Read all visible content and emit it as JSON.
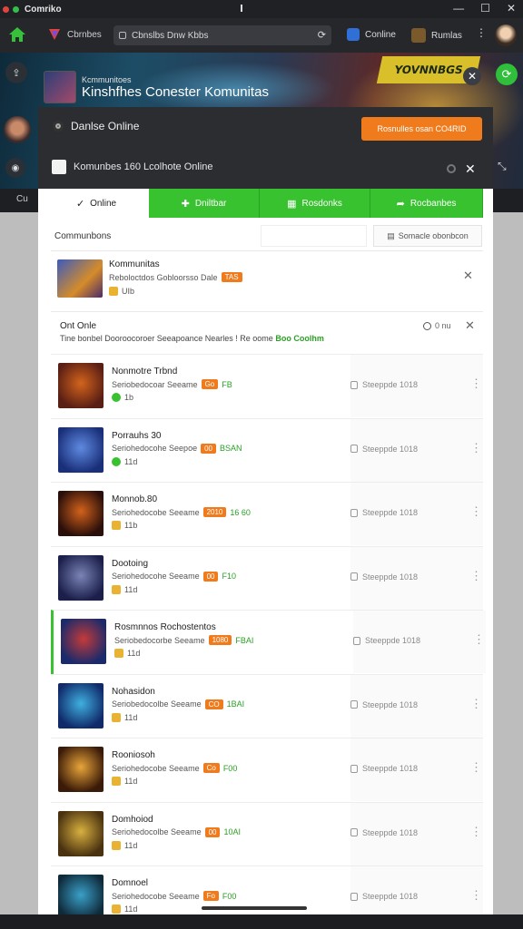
{
  "window": {
    "title": "Comriko",
    "controls": [
      "—",
      "☐",
      "✕"
    ]
  },
  "toolbar": {
    "brand_label": "Cbrnbes",
    "url": "Cbnslbs Dnw Kbbs",
    "online_label": "Conline",
    "forums_label": "Rumlas",
    "more": "⋮"
  },
  "banner": {
    "logo_text": "YOVNNBGS",
    "community_sub": "Kcmmunitoes",
    "community_title": "Kinshfhes Conester Komunitas",
    "close": "✕"
  },
  "panel": {
    "status_label": "Danlse Online",
    "join_button": "Rosnulles osan CO4RID",
    "search_label": "Komunbes  160  Lcolhote Online",
    "close": "✕"
  },
  "substrip": {
    "left": "Cu"
  },
  "tabs": [
    {
      "label": "Online",
      "icon": "check-icon",
      "active": true
    },
    {
      "label": "Dniltbar",
      "icon": "plus-icon",
      "active": false
    },
    {
      "label": "Rosdonks",
      "icon": "grid-icon",
      "active": false
    },
    {
      "label": "Rocbanbes",
      "icon": "share-icon",
      "active": false
    }
  ],
  "filter": {
    "label": "Communbons",
    "input_placeholder": "",
    "sort_button": "Somacle obonbcon"
  },
  "featured": {
    "title": "Kommunitas",
    "meta": "Reboloctdos Gobloorsso Dale",
    "badge": "TAS",
    "count": "UIb",
    "close": "✕"
  },
  "section": {
    "title": "Ont Onle",
    "desc": "Tine bonbel Dooroocoroer Seeapoance Nearles !  Re  oome",
    "desc_highlight": "Boo  Coolhm",
    "status": "0  nu",
    "close": "✕"
  },
  "rows": [
    {
      "title": "Nonmotre Trbnd",
      "meta": "Seriobedocoar Seeame",
      "badge": "Go",
      "extra": "FB",
      "count": "1b",
      "icon_color": "#38c230",
      "status": "Steeppde 1018",
      "thumb": [
        "#5a1f14",
        "#d3641c"
      ],
      "highlight": false
    },
    {
      "title": "Porrauhs 30",
      "meta": "Seriohedocohe Seepoe",
      "badge": "00",
      "extra": "BSAN",
      "count": "11d",
      "icon_color": "#38c230",
      "status": "Steeppde 1018",
      "thumb": [
        "#1a2f7a",
        "#5f8ae0"
      ],
      "highlight": false
    },
    {
      "title": "Monnob.80",
      "meta": "Seriohedocobe Seeame",
      "badge": "2010",
      "extra": "16 60",
      "count": "11b",
      "icon_color": "#e9b233",
      "status": "Steeppde 1018",
      "thumb": [
        "#2a0f0a",
        "#d3621c"
      ],
      "highlight": false
    },
    {
      "title": "Dootoing",
      "meta": "Seriohedocohe Seeame",
      "badge": "00",
      "extra": "F10",
      "count": "11d",
      "icon_color": "#e9b233",
      "status": "Steeppde 1018",
      "thumb": [
        "#1b1f4a",
        "#7a84b6"
      ],
      "highlight": false
    },
    {
      "title": "Rosmnnos Rochostentos",
      "meta": "Seriobedocorbe Seeame",
      "badge": "1080",
      "extra": "FBAI",
      "count": "11d",
      "icon_color": "#e9b233",
      "status": "Steeppde 1018",
      "thumb": [
        "#1b2a6a",
        "#c43a3a"
      ],
      "highlight": true
    },
    {
      "title": "Nohasidon",
      "meta": "Seriobedocolbe Seeame",
      "badge": "CO",
      "extra": "1BAI",
      "count": "11d",
      "icon_color": "#e9b233",
      "status": "Steeppde 1018",
      "thumb": [
        "#102a6a",
        "#3fb0e0"
      ],
      "highlight": false
    },
    {
      "title": "Rooniosoh",
      "meta": "Seriohedocobe Seeame",
      "badge": "Co",
      "extra": "F00",
      "count": "11d",
      "icon_color": "#e9b233",
      "status": "Steeppde 1018",
      "thumb": [
        "#3a1a08",
        "#e8a53a"
      ],
      "highlight": false
    },
    {
      "title": "Domhoiod",
      "meta": "Seriohedocolbe Seeame",
      "badge": "00",
      "extra": "10AI",
      "count": "11d",
      "icon_color": "#e9b233",
      "status": "Steeppde 1018",
      "thumb": [
        "#4a3210",
        "#d8b040"
      ],
      "highlight": false
    },
    {
      "title": "Domnoel",
      "meta": "Seriohedocobe Seeame",
      "badge": "Fo",
      "extra": "F00",
      "count": "11d",
      "icon_color": "#e9b233",
      "status": "Steeppde 1018",
      "thumb": [
        "#0f2a3a",
        "#3aa0c8"
      ],
      "highlight": false
    }
  ],
  "colors": {
    "accent_green": "#38c230",
    "accent_orange": "#f07b1d"
  }
}
